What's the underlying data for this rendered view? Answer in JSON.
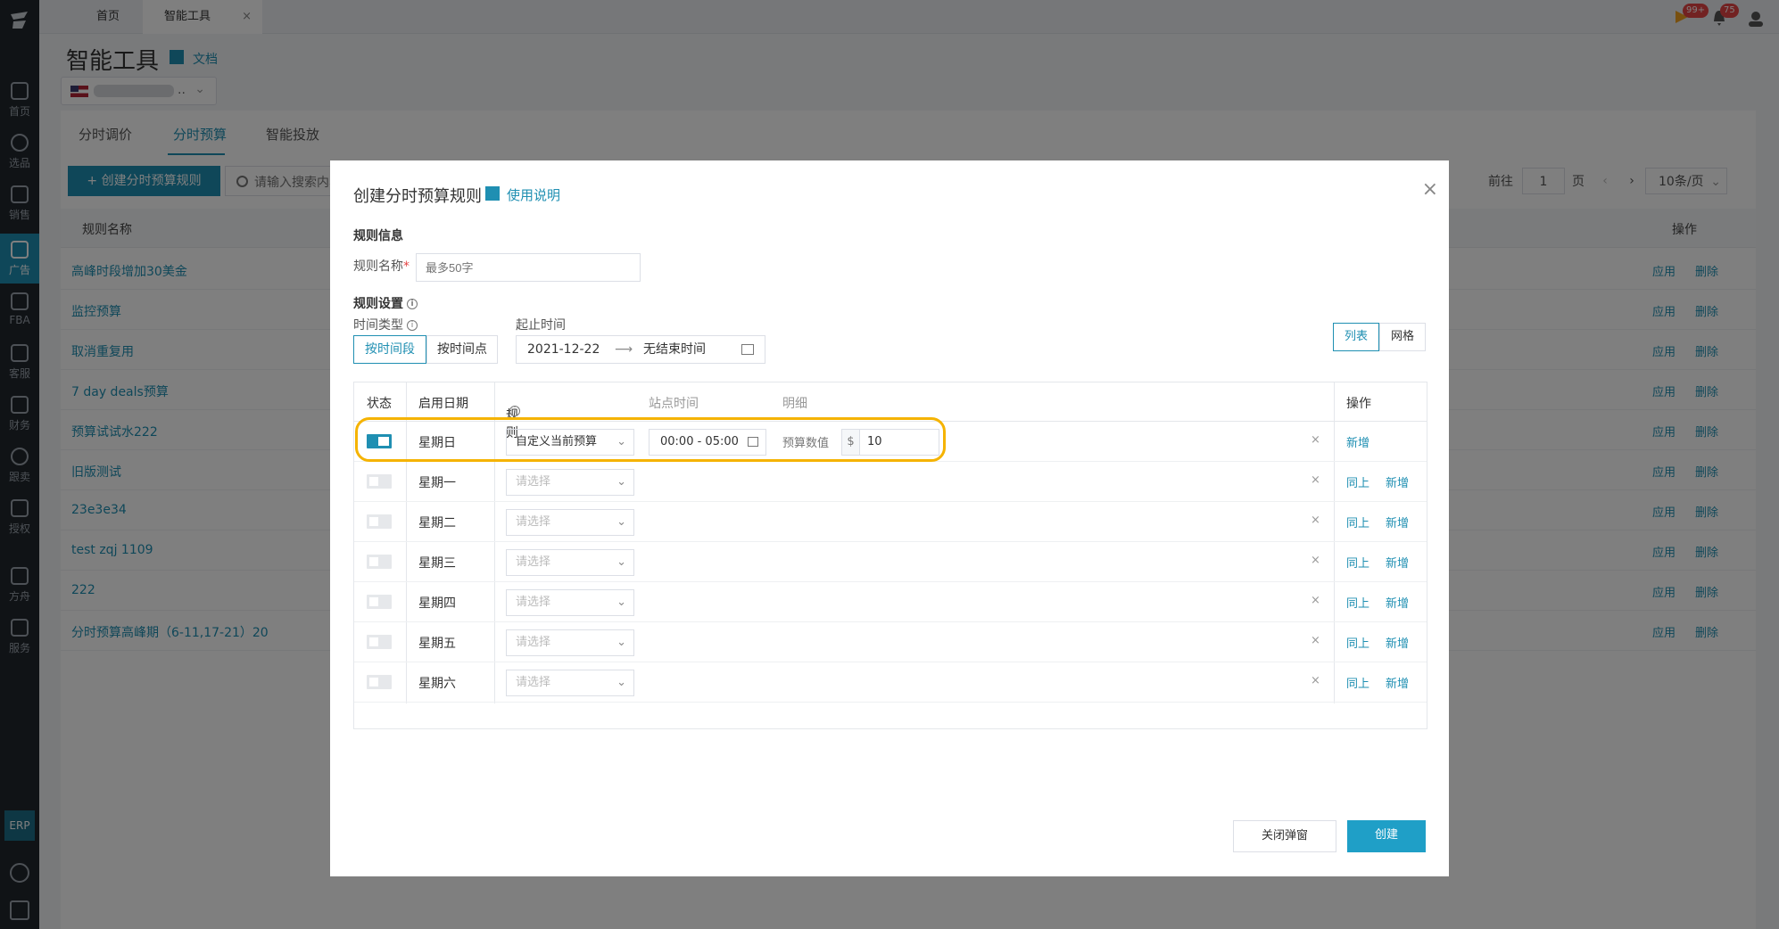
{
  "top_tabs": {
    "home": "首页",
    "tools": "智能工具",
    "close": "×"
  },
  "badges": {
    "messages": "99+",
    "alerts": "75"
  },
  "sidebar": {
    "items": [
      {
        "label": "首页",
        "icon": "home-icon"
      },
      {
        "label": "选品",
        "icon": "search-icon"
      },
      {
        "label": "销售",
        "icon": "chart-icon"
      },
      {
        "label": "广告",
        "icon": "ad-icon"
      },
      {
        "label": "FBA",
        "icon": "fba-icon"
      },
      {
        "label": "客服",
        "icon": "service-icon"
      },
      {
        "label": "财务",
        "icon": "dollar-icon"
      },
      {
        "label": "跟卖",
        "icon": "pie-icon"
      },
      {
        "label": "授权",
        "icon": "shield-icon"
      },
      {
        "label": "方舟",
        "icon": "ark-icon"
      },
      {
        "label": "服务",
        "icon": "service2-icon"
      }
    ],
    "erp": "ERP"
  },
  "header": {
    "title": "智能工具",
    "doc_link": "文档",
    "store_suffix": ".."
  },
  "tabs": {
    "t1": "分时调价",
    "t2": "分时预算",
    "t3": "智能投放"
  },
  "toolbar": {
    "create_label": "+ 创建分时预算规则",
    "search_placeholder": "请输入搜索内容"
  },
  "pager": {
    "goto": "前往",
    "page": "1",
    "page_unit": "页",
    "prev": "‹",
    "next": "›",
    "size": "10条/页"
  },
  "table": {
    "col_name": "规则名称",
    "col_ops": "操作",
    "apply": "应用",
    "delete": "删除",
    "rows": [
      "高峰时段增加30美金",
      "监控预算",
      "取消重复用",
      "7 day deals预算",
      "预算试试水222",
      "旧版测试",
      "23e3e34",
      "test zqj 1109",
      "222",
      "分时预算高峰期（6-11,17-21）20"
    ]
  },
  "modal": {
    "title": "创建分时预算规则",
    "help": "使用说明",
    "close": "×",
    "rule_info": "规则信息",
    "rule_name_label": "规则名称",
    "required_mark": "*",
    "rule_name_placeholder": "最多50字",
    "rule_settings": "规则设置",
    "time_type_label": "时间类型",
    "start_end_label": "起止时间",
    "by_period": "按时间段",
    "by_point": "按时间点",
    "start_date": "2021-12-22",
    "arrow": "⟶",
    "end_date": "无结束时间",
    "view_list": "列表",
    "view_grid": "网格",
    "cols": {
      "status": "状态",
      "date": "启用日期",
      "rule": "规则",
      "site_time": "站点时间",
      "detail": "明细",
      "ops": "操作"
    },
    "days": [
      "星期日",
      "星期一",
      "星期二",
      "星期三",
      "星期四",
      "星期五",
      "星期六"
    ],
    "row0": {
      "rule": "自定义当前预算",
      "time": "00:00 - 05:00",
      "budget_label": "预算数值",
      "currency": "$",
      "budget": "10"
    },
    "select_placeholder": "请选择",
    "same_above": "同上",
    "add": "新增",
    "del": "×",
    "cancel_btn": "关闭弹窗",
    "create_btn": "创建"
  }
}
